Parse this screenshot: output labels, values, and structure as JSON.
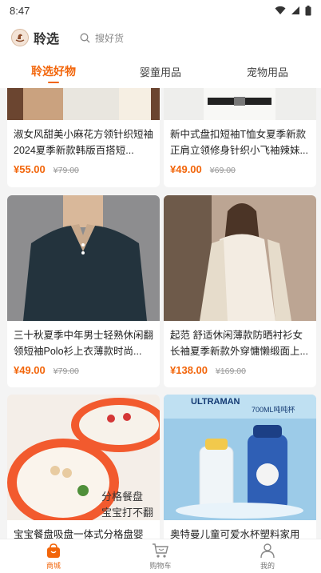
{
  "status": {
    "time": "8:47",
    "icons": [
      "wifi-icon",
      "signal-icon",
      "battery-icon"
    ]
  },
  "header": {
    "app_name": "聆选",
    "logo_icon": "rocking-horse-logo",
    "search_placeholder": "搜好货"
  },
  "tabs": [
    {
      "label": "聆选好物",
      "active": true
    },
    {
      "label": "婴童用品",
      "active": false
    },
    {
      "label": "宠物用品",
      "active": false
    }
  ],
  "products": [
    {
      "title": "淑女风甜美小麻花方领针织短袖2024夏季新款韩版百搭短...",
      "price": "¥55.00",
      "original_price": "¥79.00"
    },
    {
      "title": "新中式盘扣短袖T恤女夏季新款正肩立领修身针织小飞袖辣妹...",
      "price": "¥49.00",
      "original_price": "¥69.00"
    },
    {
      "title": "三十秋夏季中年男士轻熟休闲翻领短袖Polo衫上衣薄款时尚...",
      "price": "¥49.00",
      "original_price": "¥79.00"
    },
    {
      "title": "起范 舒适休闲薄款防晒衬衫女长袖夏季新款外穿慵懒缎面上...",
      "price": "¥138.00",
      "original_price": "¥169.00"
    },
    {
      "title": "宝宝餐盘吸盘一体式分格盘婴",
      "price": "",
      "original_price": "",
      "image_text": "分格餐盘",
      "image_text2": "宝宝打不翻"
    },
    {
      "title": "奥特曼儿童可爱水杯塑料家用",
      "price": "",
      "original_price": "",
      "image_text": "ULTRAMAN",
      "image_text2": "700ML吨吨杯"
    }
  ],
  "bottom_nav": [
    {
      "label": "商城",
      "icon": "shopping-bag-icon",
      "active": true
    },
    {
      "label": "购物车",
      "icon": "cart-icon",
      "active": false
    },
    {
      "label": "我的",
      "icon": "user-icon",
      "active": false
    }
  ],
  "colors": {
    "accent": "#f2650a",
    "background": "#f4f4f4"
  }
}
